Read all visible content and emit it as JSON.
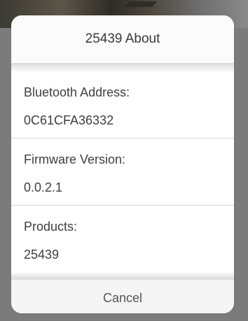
{
  "dialog": {
    "title": "25439 About",
    "rows": [
      {
        "label": "Bluetooth Address:",
        "value": "0C61CFA36332"
      },
      {
        "label": "Firmware Version:",
        "value": "0.0.2.1"
      },
      {
        "label": "Products:",
        "value": "25439"
      }
    ],
    "cancel_label": "Cancel"
  },
  "colors": {
    "backdrop": "#7b7b7b",
    "sheet": "#ffffff",
    "text": "#3e3e3e",
    "separator": "#d6d6d6"
  }
}
